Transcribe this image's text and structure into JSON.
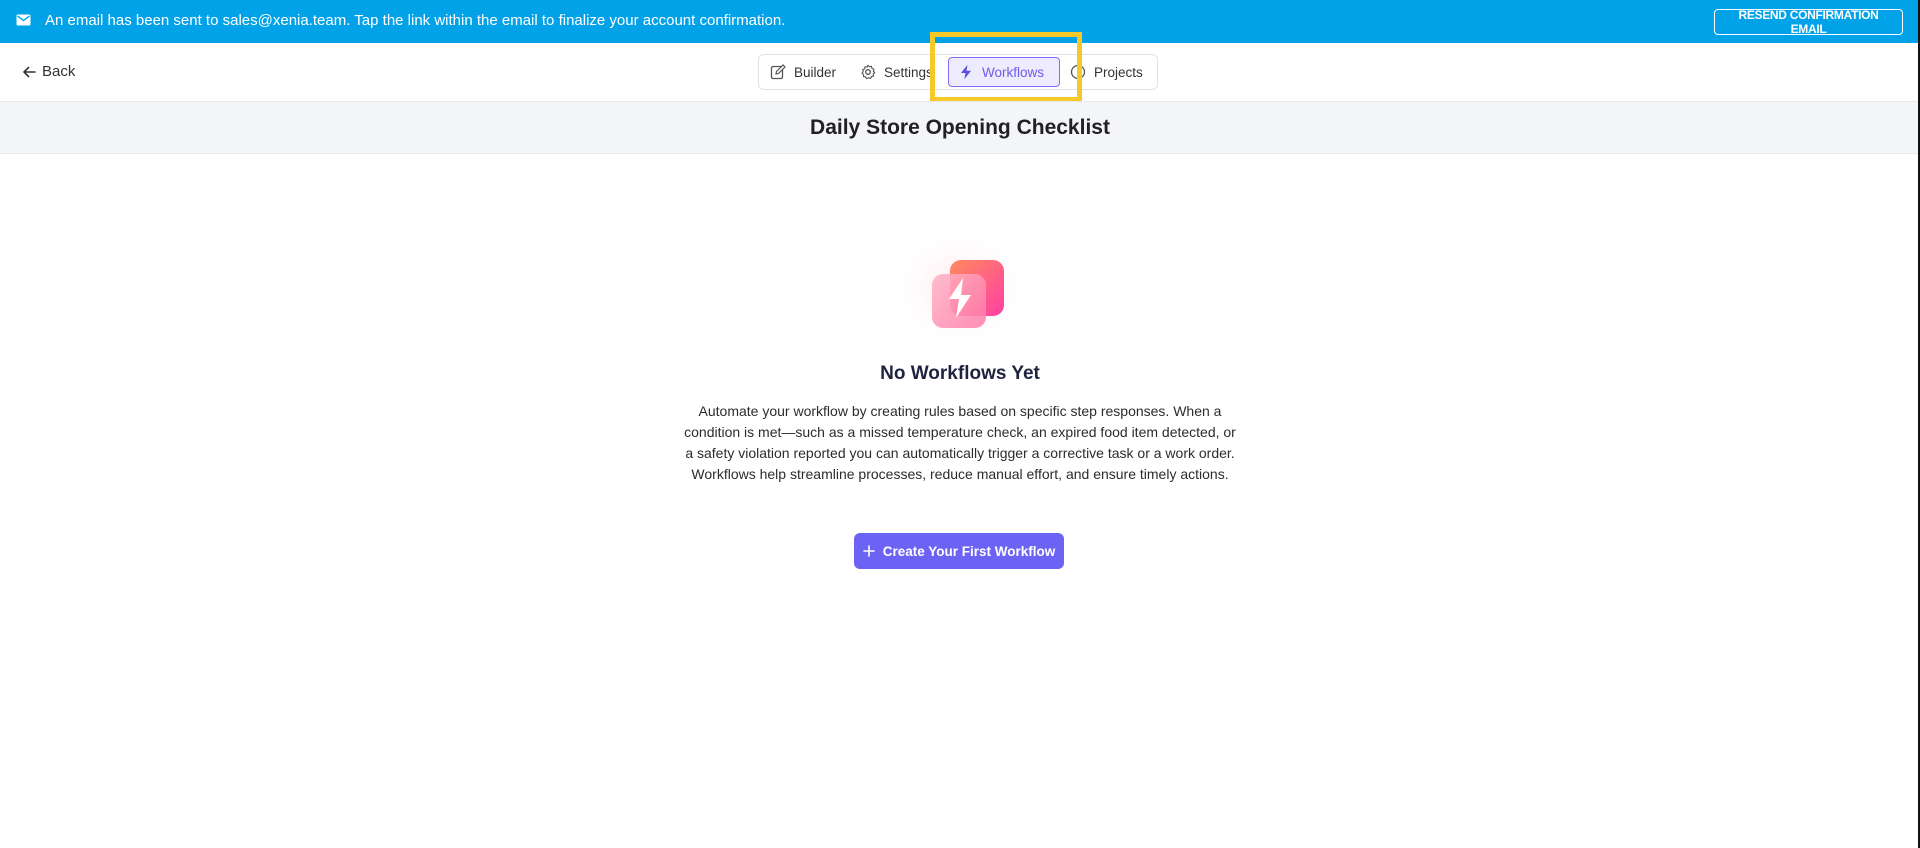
{
  "banner": {
    "message": "An email has been sent to sales@xenia.team. Tap the link within the email to finalize your account confirmation.",
    "resend_label": "RESEND CONFIRMATION EMAIL",
    "icon": "mail-icon"
  },
  "nav": {
    "back_label": "Back",
    "tabs": [
      {
        "label": "Builder",
        "icon": "edit-icon"
      },
      {
        "label": "Settings",
        "icon": "gear-icon"
      },
      {
        "label": "Workflows",
        "icon": "bolt-icon",
        "active": true
      },
      {
        "label": "Projects",
        "icon": "clock-icon"
      }
    ]
  },
  "page": {
    "title": "Daily Store Opening Checklist"
  },
  "empty_state": {
    "heading": "No Workflows Yet",
    "description": "Automate your workflow by creating rules based on specific step responses. When a condition is met—such as a missed temperature check, an expired food item detected, or a safety violation reported you can automatically trigger a corrective task or a work order. Workflows help streamline processes, reduce manual effort, and ensure timely actions.",
    "cta_label": "Create Your First Workflow"
  },
  "colors": {
    "banner": "#02a2e8",
    "accent": "#6c63f5",
    "highlight": "#f7c828"
  }
}
